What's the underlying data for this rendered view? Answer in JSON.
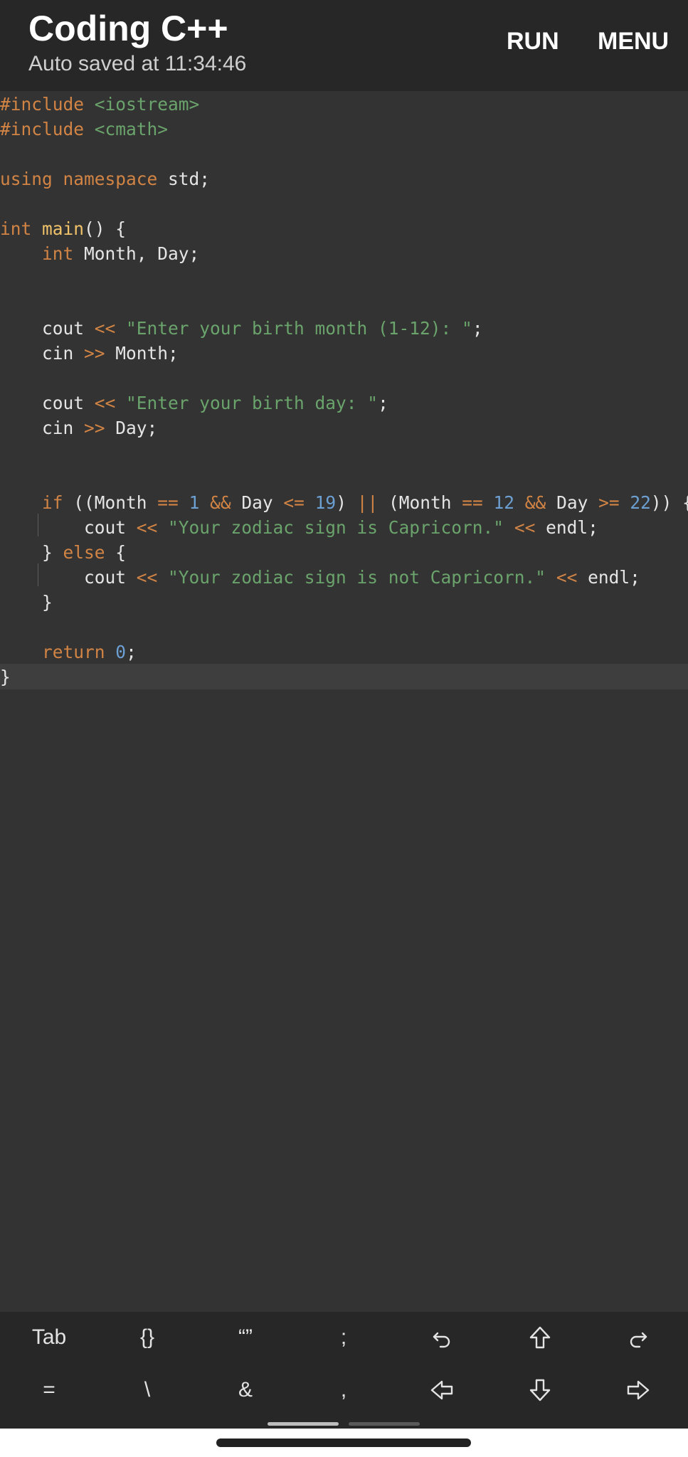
{
  "header": {
    "title": "Coding C++",
    "subtitle": "Auto saved at 11:34:46",
    "run_label": "RUN",
    "menu_label": "MENU"
  },
  "editor": {
    "colors": {
      "background": "#333333",
      "keyword": "#d28445",
      "string": "#6aa36b",
      "number": "#6c9fd2",
      "function": "#f0c36a",
      "text": "#e5e5e5"
    },
    "lines": [
      [
        {
          "t": "#include ",
          "c": "pp"
        },
        {
          "t": "<iostream>",
          "c": "inc"
        }
      ],
      [
        {
          "t": "#include ",
          "c": "pp"
        },
        {
          "t": "<cmath>",
          "c": "inc"
        }
      ],
      [],
      [
        {
          "t": "using",
          "c": "kw"
        },
        {
          "t": " ",
          "c": "plain"
        },
        {
          "t": "namespace",
          "c": "kw"
        },
        {
          "t": " std;",
          "c": "plain"
        }
      ],
      [],
      [
        {
          "t": "int",
          "c": "kw"
        },
        {
          "t": " ",
          "c": "plain"
        },
        {
          "t": "main",
          "c": "fn"
        },
        {
          "t": "() {",
          "c": "plain"
        }
      ],
      [
        {
          "t": "    ",
          "c": "plain"
        },
        {
          "t": "int",
          "c": "kw"
        },
        {
          "t": " Month, Day;",
          "c": "plain"
        }
      ],
      [],
      [],
      [
        {
          "t": "    cout ",
          "c": "plain"
        },
        {
          "t": "<<",
          "c": "op"
        },
        {
          "t": " ",
          "c": "plain"
        },
        {
          "t": "\"Enter your birth month (1-12): \"",
          "c": "str"
        },
        {
          "t": ";",
          "c": "plain"
        }
      ],
      [
        {
          "t": "    cin ",
          "c": "plain"
        },
        {
          "t": ">>",
          "c": "op"
        },
        {
          "t": " Month;",
          "c": "plain"
        }
      ],
      [],
      [
        {
          "t": "    cout ",
          "c": "plain"
        },
        {
          "t": "<<",
          "c": "op"
        },
        {
          "t": " ",
          "c": "plain"
        },
        {
          "t": "\"Enter your birth day: \"",
          "c": "str"
        },
        {
          "t": ";",
          "c": "plain"
        }
      ],
      [
        {
          "t": "    cin ",
          "c": "plain"
        },
        {
          "t": ">>",
          "c": "op"
        },
        {
          "t": " Day;",
          "c": "plain"
        }
      ],
      [],
      [],
      [
        {
          "t": "    ",
          "c": "plain"
        },
        {
          "t": "if",
          "c": "kw"
        },
        {
          "t": " ((Month ",
          "c": "plain"
        },
        {
          "t": "==",
          "c": "op"
        },
        {
          "t": " ",
          "c": "plain"
        },
        {
          "t": "1",
          "c": "num"
        },
        {
          "t": " ",
          "c": "plain"
        },
        {
          "t": "&&",
          "c": "op"
        },
        {
          "t": " Day ",
          "c": "plain"
        },
        {
          "t": "<=",
          "c": "op"
        },
        {
          "t": " ",
          "c": "plain"
        },
        {
          "t": "19",
          "c": "num"
        },
        {
          "t": ") ",
          "c": "plain"
        },
        {
          "t": "||",
          "c": "op"
        },
        {
          "t": " (Month ",
          "c": "plain"
        },
        {
          "t": "==",
          "c": "op"
        },
        {
          "t": " ",
          "c": "plain"
        },
        {
          "t": "12",
          "c": "num"
        },
        {
          "t": " ",
          "c": "plain"
        },
        {
          "t": "&&",
          "c": "op"
        },
        {
          "t": " Day ",
          "c": "plain"
        },
        {
          "t": ">=",
          "c": "op"
        },
        {
          "t": " ",
          "c": "plain"
        },
        {
          "t": "22",
          "c": "num"
        },
        {
          "t": ")) {",
          "c": "plain"
        }
      ],
      [
        {
          "t": "        cout ",
          "c": "plain"
        },
        {
          "t": "<<",
          "c": "op"
        },
        {
          "t": " ",
          "c": "plain"
        },
        {
          "t": "\"Your zodiac sign is Capricorn.\"",
          "c": "str"
        },
        {
          "t": " ",
          "c": "plain"
        },
        {
          "t": "<<",
          "c": "op"
        },
        {
          "t": " endl;",
          "c": "plain"
        }
      ],
      [
        {
          "t": "    } ",
          "c": "plain"
        },
        {
          "t": "else",
          "c": "kw"
        },
        {
          "t": " {",
          "c": "plain"
        }
      ],
      [
        {
          "t": "        cout ",
          "c": "plain"
        },
        {
          "t": "<<",
          "c": "op"
        },
        {
          "t": " ",
          "c": "plain"
        },
        {
          "t": "\"Your zodiac sign is not Capricorn.\"",
          "c": "str"
        },
        {
          "t": " ",
          "c": "plain"
        },
        {
          "t": "<<",
          "c": "op"
        },
        {
          "t": " endl;",
          "c": "plain"
        }
      ],
      [
        {
          "t": "    }",
          "c": "plain"
        }
      ],
      [],
      [
        {
          "t": "    ",
          "c": "plain"
        },
        {
          "t": "return",
          "c": "kw"
        },
        {
          "t": " ",
          "c": "plain"
        },
        {
          "t": "0",
          "c": "num"
        },
        {
          "t": ";",
          "c": "plain"
        }
      ],
      [
        {
          "t": "}",
          "c": "plain"
        }
      ]
    ],
    "current_line": 23
  },
  "toolbar": {
    "row1": [
      {
        "name": "tab-key",
        "label": "Tab"
      },
      {
        "name": "braces-key",
        "label": "{}"
      },
      {
        "name": "quotes-key",
        "label": "“”"
      },
      {
        "name": "semicolon-key",
        "label": ";"
      },
      {
        "name": "undo-key",
        "icon": "undo-icon"
      },
      {
        "name": "arrow-up-key",
        "icon": "arrow-up-icon"
      },
      {
        "name": "redo-key",
        "icon": "redo-icon"
      }
    ],
    "row2": [
      {
        "name": "equals-key",
        "label": "="
      },
      {
        "name": "backslash-key",
        "label": "\\"
      },
      {
        "name": "ampersand-key",
        "label": "&"
      },
      {
        "name": "comma-key",
        "label": ","
      },
      {
        "name": "arrow-left-key",
        "icon": "arrow-left-icon"
      },
      {
        "name": "arrow-down-key",
        "icon": "arrow-down-icon"
      },
      {
        "name": "arrow-right-key",
        "icon": "arrow-right-icon"
      }
    ],
    "page_indicator": {
      "pages": 2,
      "current": 1
    }
  }
}
